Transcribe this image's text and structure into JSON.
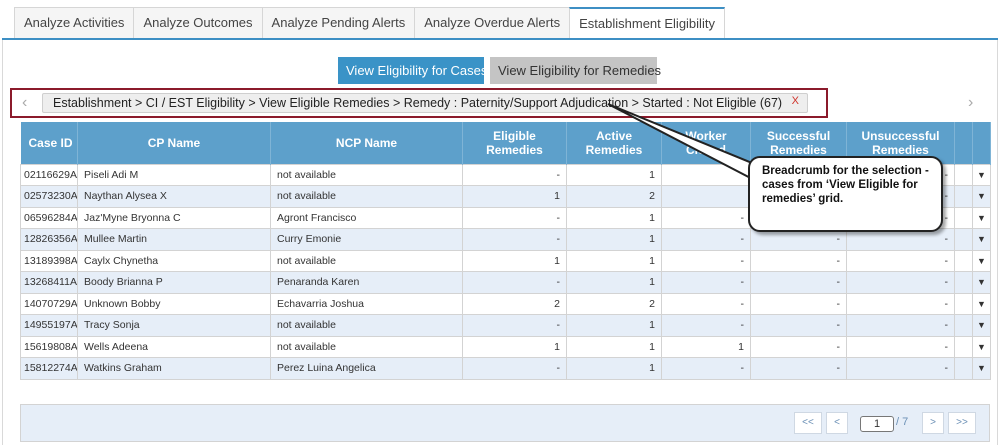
{
  "tabs": [
    {
      "label": "Analyze Activities"
    },
    {
      "label": "Analyze Outcomes"
    },
    {
      "label": "Analyze Pending Alerts"
    },
    {
      "label": "Analyze Overdue Alerts"
    },
    {
      "label": "Establishment Eligibility"
    }
  ],
  "active_tab_index": 4,
  "view_buttons": {
    "cases": "View Eligibility for Cases",
    "remedies": "View Eligibility for Remedies"
  },
  "breadcrumb": {
    "text": "Establishment > CI / EST Eligibility > View Eligible Remedies > Remedy : Paternity/Support Adjudication > Started : Not Eligible (67)",
    "close": "X",
    "prev_icon": "‹",
    "next_icon": "›"
  },
  "grid": {
    "columns": [
      "Case ID",
      "CP Name",
      "NCP Name",
      "Eligible Remedies",
      "Active Remedies",
      "Worker Closed",
      "Successful Remedies",
      "Unsuccessful Remedies"
    ],
    "rows": [
      {
        "case_id": "02116629A",
        "cp": "Piseli Adi M",
        "ncp": "not available",
        "eligible": "-",
        "active": "1",
        "worker_closed": "",
        "successful": "",
        "unsuccessful": "-"
      },
      {
        "case_id": "02573230A",
        "cp": "Naythan Alysea X",
        "ncp": "not available",
        "eligible": "1",
        "active": "2",
        "worker_closed": "",
        "successful": "",
        "unsuccessful": "-"
      },
      {
        "case_id": "06596284A",
        "cp": "Jaz'Myne Bryonna C",
        "ncp": "Agront Francisco",
        "eligible": "-",
        "active": "1",
        "worker_closed": "-",
        "successful": "",
        "unsuccessful": "-"
      },
      {
        "case_id": "12826356A",
        "cp": "Mullee Martin",
        "ncp": "Curry Emonie",
        "eligible": "-",
        "active": "1",
        "worker_closed": "-",
        "successful": "-",
        "unsuccessful": "-"
      },
      {
        "case_id": "13189398A",
        "cp": "Caylx Chynetha",
        "ncp": "not available",
        "eligible": "1",
        "active": "1",
        "worker_closed": "-",
        "successful": "-",
        "unsuccessful": "-"
      },
      {
        "case_id": "13268411A",
        "cp": "Boody Brianna P",
        "ncp": "Penaranda Karen",
        "eligible": "-",
        "active": "1",
        "worker_closed": "-",
        "successful": "-",
        "unsuccessful": "-"
      },
      {
        "case_id": "14070729A",
        "cp": "Unknown Bobby",
        "ncp": "Echavarria Joshua",
        "eligible": "2",
        "active": "2",
        "worker_closed": "-",
        "successful": "-",
        "unsuccessful": "-"
      },
      {
        "case_id": "14955197A",
        "cp": "Tracy Sonja",
        "ncp": "not available",
        "eligible": "-",
        "active": "1",
        "worker_closed": "-",
        "successful": "-",
        "unsuccessful": "-"
      },
      {
        "case_id": "15619808A",
        "cp": "Wells Adeena",
        "ncp": "not available",
        "eligible": "1",
        "active": "1",
        "worker_closed": "1",
        "successful": "-",
        "unsuccessful": "-"
      },
      {
        "case_id": "15812274A",
        "cp": "Watkins Graham",
        "ncp": "Perez Luina Angelica",
        "eligible": "-",
        "active": "1",
        "worker_closed": "-",
        "successful": "-",
        "unsuccessful": "-"
      }
    ],
    "row_menu_icon": "▼"
  },
  "pager": {
    "first": "<<",
    "prev": "<",
    "page": "1",
    "total": "/ 7",
    "next": ">",
    "last": ">>"
  },
  "callout": {
    "text": "Breadcrumb for the selection - cases from ‘View Eligible for remedies’ grid."
  },
  "colors": {
    "accent": "#3a93c7",
    "header": "#5da0cb",
    "highlight_border": "#8b1a2b",
    "alt_row": "#e6eef8"
  }
}
